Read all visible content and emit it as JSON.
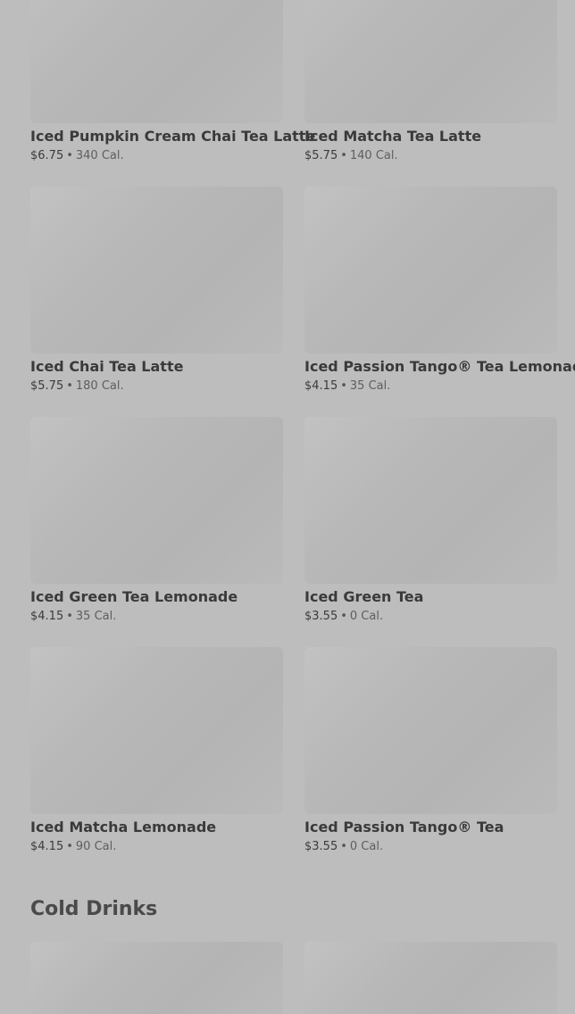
{
  "items": [
    {
      "name": "Iced Pumpkin Cream Chai Tea Latte",
      "price": "$6.75",
      "calories": "340 Cal."
    },
    {
      "name": "Iced Matcha Tea Latte",
      "price": "$5.75",
      "calories": "140 Cal."
    },
    {
      "name": "Iced Chai Tea Latte",
      "price": "$5.75",
      "calories": "180 Cal."
    },
    {
      "name": "Iced Passion Tango® Tea Lemonade",
      "price": "$4.15",
      "calories": "35 Cal."
    },
    {
      "name": "Iced Green Tea Lemonade",
      "price": "$4.15",
      "calories": "35 Cal."
    },
    {
      "name": "Iced Green Tea",
      "price": "$3.55",
      "calories": "0 Cal."
    },
    {
      "name": "Iced Matcha Lemonade",
      "price": "$4.15",
      "calories": "90 Cal."
    },
    {
      "name": "Iced Passion Tango® Tea",
      "price": "$3.55",
      "calories": "0 Cal."
    }
  ],
  "section": {
    "title": "Cold Drinks"
  },
  "separator": "•"
}
